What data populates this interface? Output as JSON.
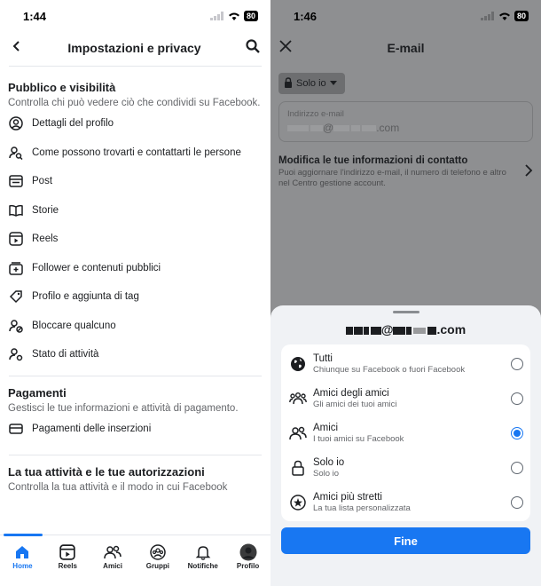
{
  "left": {
    "status": {
      "time": "1:44",
      "battery": "80"
    },
    "header": {
      "title": "Impostazioni e privacy"
    },
    "sections": [
      {
        "title": "Pubblico e visibilità",
        "desc": "Controlla chi può vedere ciò che condividi su Facebook.",
        "items": [
          "Dettagli del profilo",
          "Come possono trovarti e contattarti le persone",
          "Post",
          "Storie",
          "Reels",
          "Follower e contenuti pubblici",
          "Profilo e aggiunta di tag",
          "Bloccare qualcuno",
          "Stato di attività"
        ]
      },
      {
        "title": "Pagamenti",
        "desc": "Gestisci le tue informazioni e attività di pagamento.",
        "items": [
          "Pagamenti delle inserzioni"
        ]
      },
      {
        "title": "La tua attività e le tue autorizzazioni",
        "desc": "Controlla la tua attività e il modo in cui Facebook"
      }
    ],
    "tabs": [
      "Home",
      "Reels",
      "Amici",
      "Gruppi",
      "Notifiche",
      "Profilo"
    ]
  },
  "right": {
    "status": {
      "time": "1:46",
      "battery": "80"
    },
    "header": {
      "title": "E-mail"
    },
    "privacy_button": "Solo io",
    "email_field": {
      "label": "Indirizzo e-mail",
      "value_suffix": ".com"
    },
    "contact": {
      "title": "Modifica le tue informazioni di contatto",
      "desc": "Puoi aggiornare l'indirizzo e-mail, il numero di telefono e altro nel Centro gestione account."
    },
    "sheet": {
      "email_suffix": ".com",
      "options": [
        {
          "title": "Tutti",
          "desc": "Chiunque su Facebook o fuori Facebook",
          "icon": "globe-icon",
          "selected": false
        },
        {
          "title": "Amici degli amici",
          "desc": "Gli amici dei tuoi amici",
          "icon": "friends-of-friends-icon",
          "selected": false
        },
        {
          "title": "Amici",
          "desc": "I tuoi amici su Facebook",
          "icon": "friends-icon",
          "selected": true
        },
        {
          "title": "Solo io",
          "desc": "Solo io",
          "icon": "lock-icon",
          "selected": false
        },
        {
          "title": "Amici più stretti",
          "desc": "La tua lista personalizzata",
          "icon": "star-circle-icon",
          "selected": false
        }
      ],
      "done_label": "Fine"
    }
  },
  "colors": {
    "accent": "#1877f2"
  }
}
